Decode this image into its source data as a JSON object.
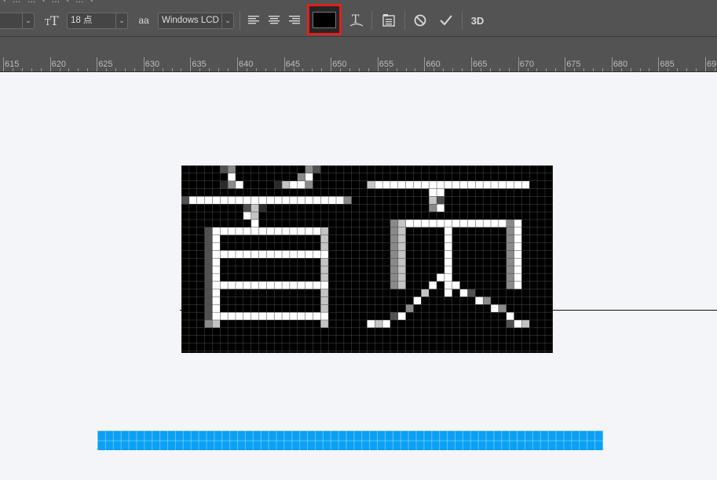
{
  "menu_strip": [
    "‹",
    "…",
    "…",
    "‹",
    "…",
    "‹",
    "…",
    "‹"
  ],
  "toolbar": {
    "font_style_value": "",
    "font_size_value": "18 点",
    "anti_alias_icon": "aa",
    "anti_alias_value": "Windows LCD",
    "text_color": "#000000",
    "three_d_label": "3D"
  },
  "ruler": {
    "labels": [
      "615",
      "620",
      "625",
      "630",
      "635",
      "640",
      "645",
      "650",
      "655",
      "660",
      "665",
      "670",
      "675",
      "680",
      "685",
      "69"
    ]
  },
  "canvas": {
    "pixel_text": "首页",
    "pixel_block_bg": "#000000",
    "blue_bar_color": "#0aa0f5"
  }
}
